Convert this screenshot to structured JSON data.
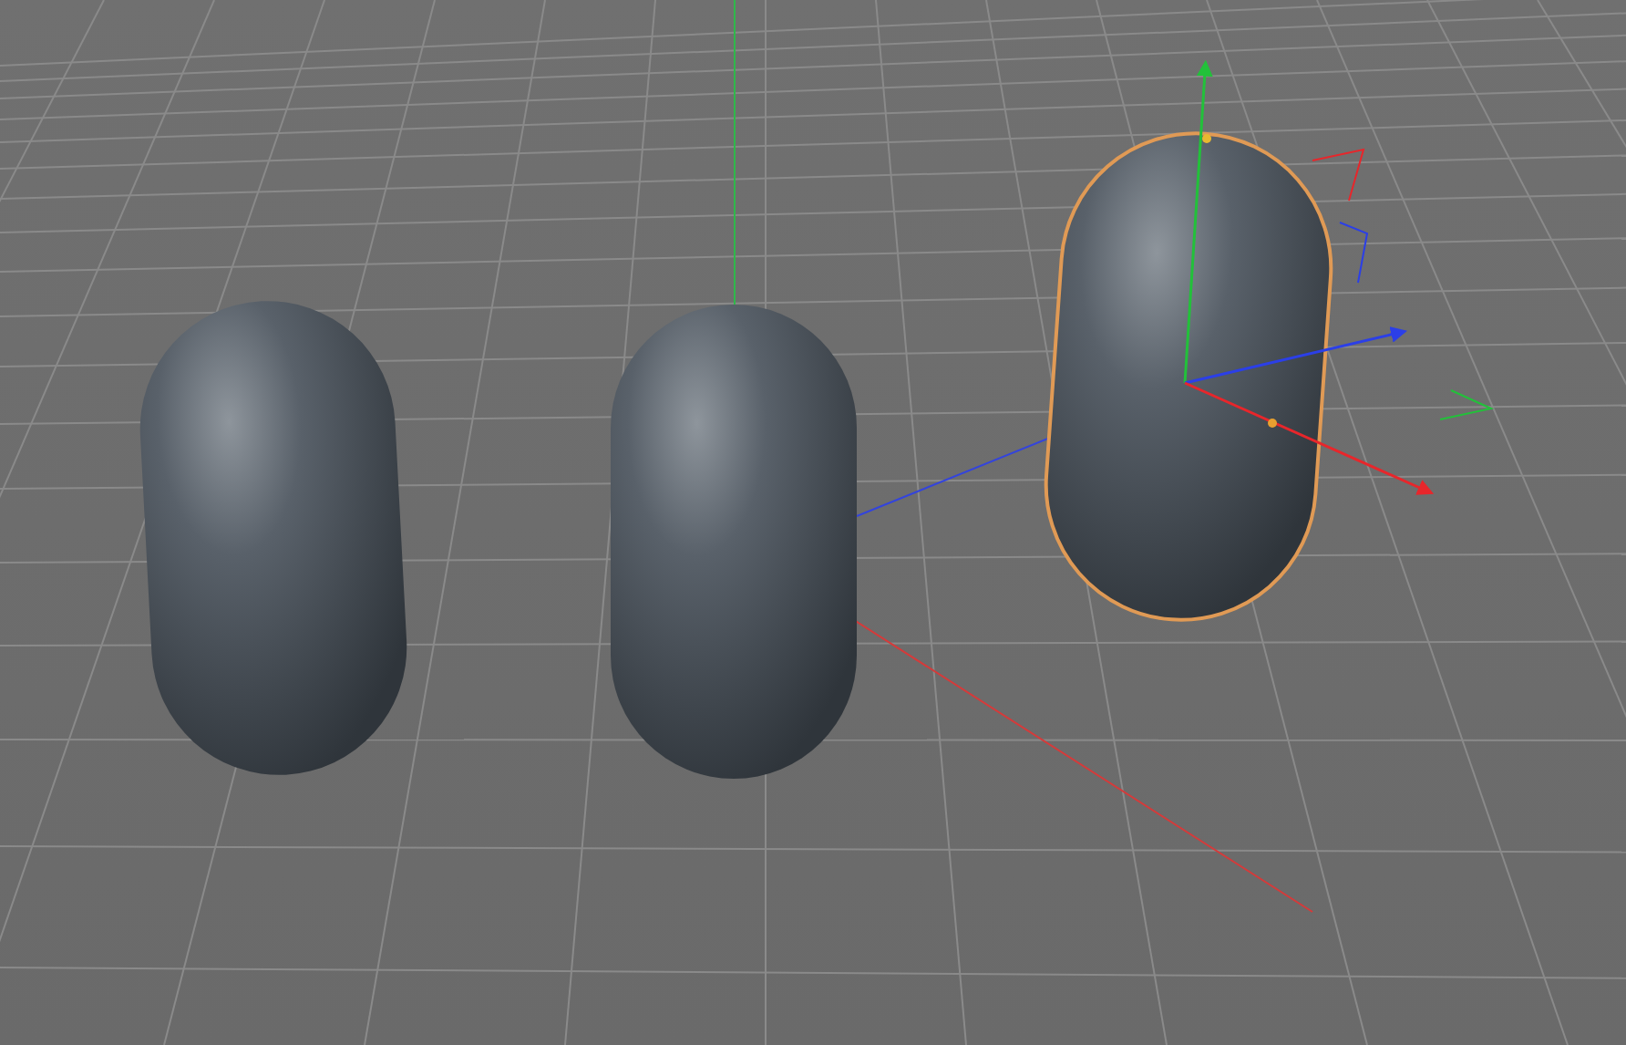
{
  "viewport": {
    "objects": [
      {
        "kind": "capsule",
        "selected": false
      },
      {
        "kind": "capsule",
        "selected": false
      },
      {
        "kind": "capsule",
        "selected": true
      }
    ]
  }
}
